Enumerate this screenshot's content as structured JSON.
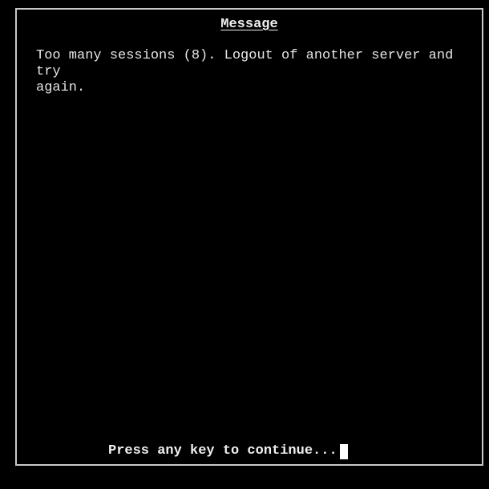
{
  "dialog": {
    "title": "Message",
    "message_line1": "Too many sessions (8). Logout of another server and try",
    "message_line2": "again.",
    "prompt": "Press any key to continue..."
  },
  "colors": {
    "background": "#000000",
    "text": "#e8e8e8",
    "border": "#c8c8c8",
    "cursor": "#ffffff"
  }
}
